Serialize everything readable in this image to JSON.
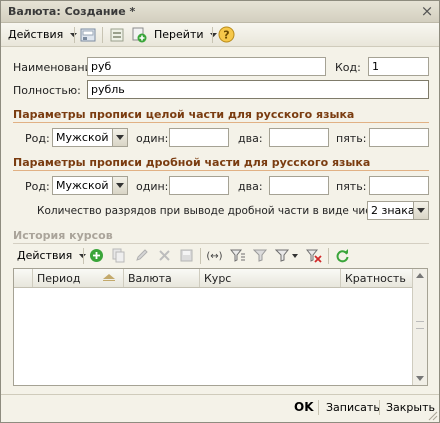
{
  "window": {
    "title": "Валюта: Создание *",
    "close_glyph": "×"
  },
  "toolbar": {
    "actions_label": "Действия",
    "goto_label": "Перейти"
  },
  "form": {
    "name_label": "Наименование:",
    "name_value": "руб",
    "code_label": "Код:",
    "code_value": "1",
    "full_label": "Полностью:",
    "full_value": "рубль"
  },
  "section_integer": {
    "title": "Параметры прописи целой части для русского языка",
    "gender_label": "Род:",
    "gender_value": "Мужской",
    "one_label": "один:",
    "two_label": "два:",
    "five_label": "пять:",
    "one_value": "",
    "two_value": "",
    "five_value": ""
  },
  "section_fraction": {
    "title": "Параметры прописи дробной части для русского языка",
    "gender_label": "Род:",
    "gender_value": "Мужской",
    "one_label": "один:",
    "two_label": "два:",
    "five_label": "пять:",
    "one_value": "",
    "two_value": "",
    "five_value": "",
    "digits_label": "Количество разрядов при выводе дробной части в виде числа:",
    "digits_value": "2 знака"
  },
  "history": {
    "title": "История курсов",
    "actions_label": "Действия",
    "columns": [
      "Период",
      "Валюта",
      "Курс",
      "Кратность"
    ]
  },
  "footer": {
    "ok_label": "OK",
    "save_label": "Записать",
    "close_label": "Закрыть"
  },
  "colors": {
    "section_title": "#7a3c10",
    "section_line": "#e1b184",
    "window_bg": "#f4f2e8"
  }
}
